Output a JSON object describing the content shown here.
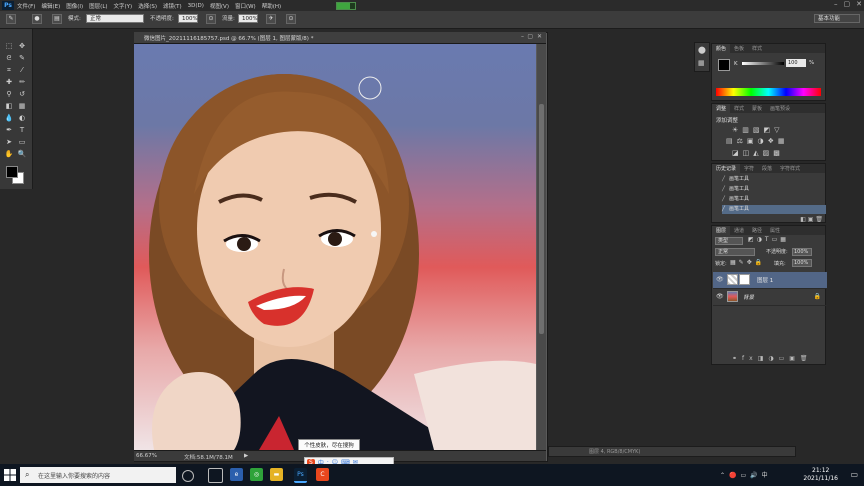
{
  "app": {
    "logo": "Ps"
  },
  "menu": [
    "文件(F)",
    "编辑(E)",
    "图像(I)",
    "图层(L)",
    "文字(Y)",
    "选择(S)",
    "滤镜(T)",
    "3D(D)",
    "视图(V)",
    "窗口(W)",
    "帮助(H)"
  ],
  "options": {
    "mode_label": "模式:",
    "mode_value": "正常",
    "opacity_label": "不透明度:",
    "opacity_value": "100%",
    "flow_label": "流量:",
    "flow_value": "100%",
    "workspace_value": "基本功能"
  },
  "document": {
    "tab_title": "微信图片_20211116185757.psd @ 66.7% (图层 1, 图层蒙版/8) *",
    "zoom": "66.67%",
    "doc_info": "文档:58.1M/78.1M",
    "second_tab_title": "图层 4, RGB/8/CMYK)"
  },
  "tooltip": "个性皮肤，尽在搜狗",
  "color_panel": {
    "tabs": [
      "颜色",
      "色板",
      "样式"
    ],
    "channel": "K",
    "value": "100",
    "unit": "%"
  },
  "adjust_panel": {
    "tabs": [
      "调整",
      "样式",
      "蒙板",
      "画笔预设"
    ],
    "title": "添加调整"
  },
  "history_panel": {
    "tabs": [
      "历史记录",
      "字符",
      "段落",
      "字符样式",
      "字符样式"
    ],
    "items": [
      "画笔工具",
      "画笔工具",
      "画笔工具",
      "画笔工具"
    ]
  },
  "layers_panel": {
    "tabs": [
      "图层",
      "通道",
      "路径",
      "属性"
    ],
    "kind_label": "类型",
    "blend_value": "正常",
    "opacity_label": "不透明度:",
    "opacity_value": "100%",
    "lock_label": "锁定:",
    "fill_label": "填充:",
    "fill_value": "100%",
    "layers": [
      {
        "name": "图层 1",
        "selected": true
      },
      {
        "name": "背景",
        "selected": false
      }
    ]
  },
  "taskbar": {
    "search_placeholder": "在这里输入你要搜索的内容",
    "time": "21:12",
    "date": "2021/11/16"
  },
  "ime": [
    "中",
    "·",
    "☺",
    "⌨",
    "✉"
  ]
}
